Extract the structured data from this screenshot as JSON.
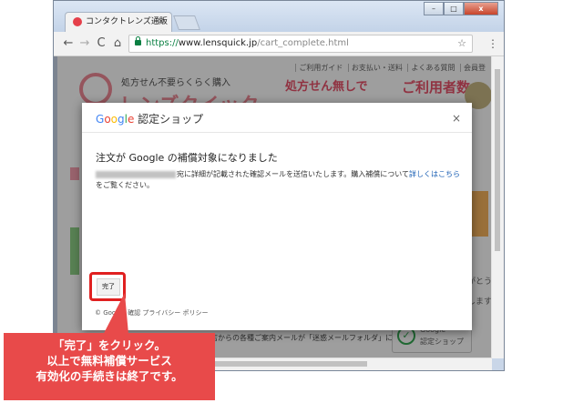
{
  "browser": {
    "tab_title": "コンタクトレンズ通販",
    "tab_close": "×",
    "url_scheme": "https://",
    "url_host": "www.lensquick.jp",
    "url_path": "/cart_complete.html",
    "window_buttons": {
      "minimize": "–",
      "maximize": "□",
      "close": "x"
    },
    "nav": {
      "back": "←",
      "forward": "→",
      "reload": "C",
      "home": "⌂"
    },
    "bookmark_star": "☆",
    "menu": "⋮"
  },
  "site": {
    "nav_items": [
      "ご利用ガイド",
      "お支払い・送料",
      "よくある質問",
      "会員登"
    ],
    "tagline": "処方せん不要らくらく購入",
    "logo_text": "レンズクイック",
    "banner1_line1": "処方せん無しで",
    "banner2_line1": "ご利用者数",
    "sidebar_text_1": "がとう",
    "sidebar_text_2": "します",
    "bottom_text": "店からの各種ご案内メールが「迷惑メールフォルダ」に振りわ",
    "cert_badge_line1": "Google",
    "cert_badge_line2": "認定ショップ"
  },
  "dialog": {
    "title_google": "Google",
    "title_rest": " 認定ショップ",
    "close": "×",
    "heading": "注文が Google の補償対象になりました",
    "body_before_link": "宛に詳細が記載された確認メールを送信いたします。購入補償について",
    "body_link": "詳しくはこちら",
    "body_after_link": "をご覧ください。",
    "done_button": "完了",
    "footer": "© Google 確認 プライバシー ポリシー"
  },
  "annotation": {
    "line1": "「完了」をクリック。",
    "line2": "以上で無料補償サービス",
    "line3": "有効化の手続きは終了です。"
  }
}
